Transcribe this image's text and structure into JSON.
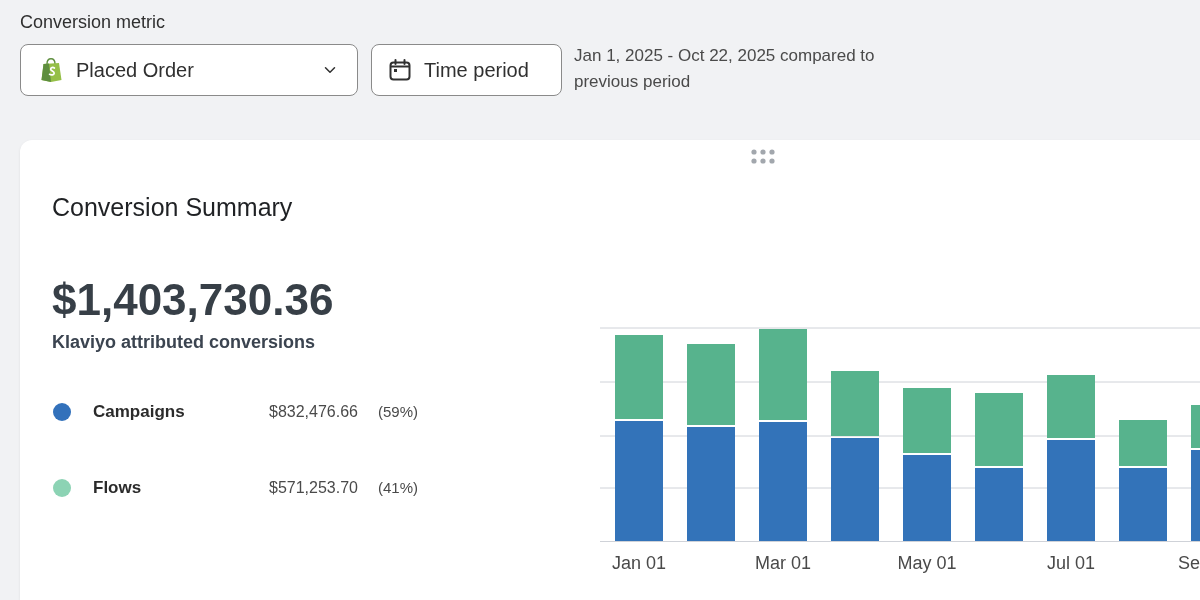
{
  "filter": {
    "label": "Conversion metric",
    "metric_dropdown": {
      "value": "Placed Order"
    },
    "time_button": {
      "label": "Time period"
    },
    "date_range": "Jan 1, 2025 - Oct 22, 2025 compared to previous period"
  },
  "summary_card": {
    "title": "Conversion Summary",
    "total": "$1,403,730.36",
    "total_label": "Klaviyo attributed conversions",
    "breakdown": [
      {
        "name": "Campaigns",
        "color": "#3271bb",
        "amount": "$832,476.66",
        "share": "(59%)"
      },
      {
        "name": "Flows",
        "color": "#8cd3b4",
        "amount": "$571,253.70",
        "share": "(41%)"
      }
    ],
    "chart": {
      "x_labels": [
        "Jan 01",
        "Mar 01",
        "May 01",
        "Jul 01",
        "Se"
      ]
    }
  }
}
